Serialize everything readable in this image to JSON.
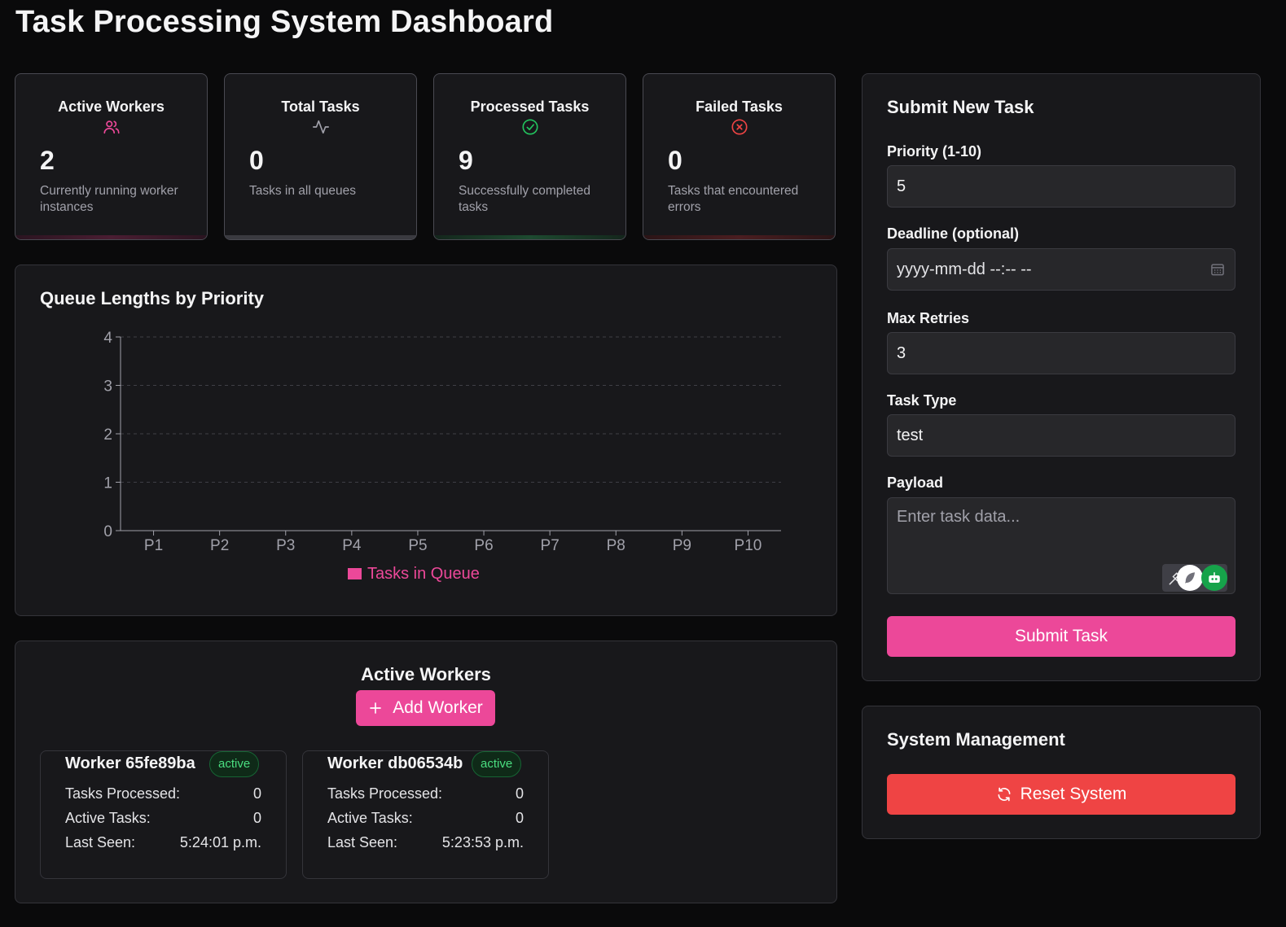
{
  "page_title": "Task Processing System Dashboard",
  "stats": [
    {
      "title": "Active Workers",
      "icon": "users-icon",
      "value": "2",
      "desc": "Currently running worker instances",
      "color": "#ec4899"
    },
    {
      "title": "Total Tasks",
      "icon": "activity-icon",
      "value": "0",
      "desc": "Tasks in all queues",
      "color": "#a1a1aa"
    },
    {
      "title": "Processed Tasks",
      "icon": "check-circle-icon",
      "value": "9",
      "desc": "Successfully completed tasks",
      "color": "#22c55e"
    },
    {
      "title": "Failed Tasks",
      "icon": "x-circle-icon",
      "value": "0",
      "desc": "Tasks that encountered errors",
      "color": "#ef4444"
    }
  ],
  "queue_chart": {
    "title": "Queue Lengths by Priority",
    "legend_label": "Tasks in Queue"
  },
  "chart_data": {
    "type": "bar",
    "categories": [
      "P1",
      "P2",
      "P3",
      "P4",
      "P5",
      "P6",
      "P7",
      "P8",
      "P9",
      "P10"
    ],
    "y_ticks": [
      "0",
      "1",
      "2",
      "3",
      "4"
    ],
    "series": [
      {
        "name": "Tasks in Queue",
        "values": [
          0,
          0,
          0,
          0,
          0,
          0,
          0,
          0,
          0,
          0
        ],
        "color": "#ec4899"
      }
    ],
    "ylim": [
      0,
      4
    ],
    "grid": true,
    "legend_position": "bottom"
  },
  "workers_section": {
    "title": "Active Workers",
    "add_button": "Add Worker",
    "add_icon": "plus-icon",
    "row_labels": {
      "processed": "Tasks Processed:",
      "active": "Active Tasks:",
      "last_seen": "Last Seen:"
    },
    "workers": [
      {
        "name": "Worker 65fe89ba",
        "status": "active",
        "processed": "0",
        "active": "0",
        "last_seen": "5:24:01 p.m."
      },
      {
        "name": "Worker db06534b",
        "status": "active",
        "processed": "0",
        "active": "0",
        "last_seen": "5:23:53 p.m."
      }
    ]
  },
  "submit_form": {
    "title": "Submit New Task",
    "priority_label": "Priority (1-10)",
    "priority_value": "5",
    "deadline_label": "Deadline (optional)",
    "deadline_placeholder": "yyyy-mm-dd --:-- --",
    "retries_label": "Max Retries",
    "retries_value": "3",
    "type_label": "Task Type",
    "type_value": "test",
    "payload_label": "Payload",
    "payload_placeholder": "Enter task data...",
    "submit_label": "Submit Task",
    "submit_color": "#ec4899"
  },
  "system_management": {
    "title": "System Management",
    "reset_label": "Reset System",
    "reset_icon": "refresh-icon",
    "reset_color": "#ef4444"
  }
}
